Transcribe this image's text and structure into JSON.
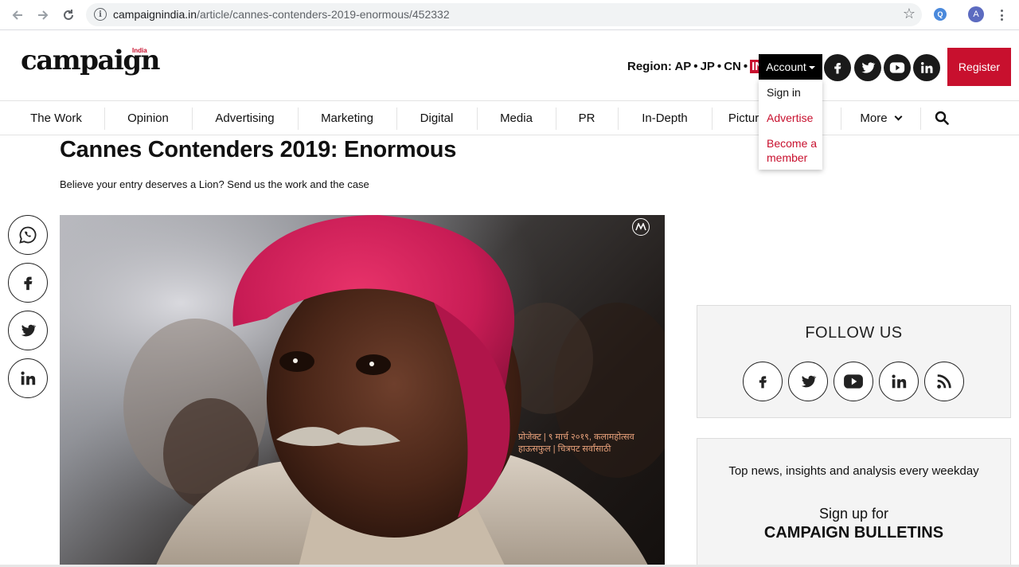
{
  "browser": {
    "url_host": "campaignindia.in",
    "url_path": "/article/cannes-contenders-2019-enormous/452332",
    "ext_label": "Q",
    "avatar_letter": "A"
  },
  "header": {
    "logo": "campaign",
    "logo_sup": "India",
    "region_label": "Region:",
    "regions": [
      "AP",
      "JP",
      "CN",
      "IN"
    ],
    "account_label": "Account",
    "register_label": "Register"
  },
  "account_menu": {
    "items": [
      {
        "label": "Sign in"
      },
      {
        "label": "Advertise"
      },
      {
        "label": "Become a member"
      }
    ]
  },
  "nav": {
    "items": [
      "The Work",
      "Opinion",
      "Advertising",
      "Marketing",
      "Digital",
      "Media",
      "PR",
      "In-Depth",
      "Pictures"
    ],
    "more_label": "More"
  },
  "article": {
    "title": "Cannes Contenders 2019: Enormous",
    "subtitle": "Believe your entry deserves a Lion? Send us the work and the case",
    "hero_caption_line1": "प्रोजेक्ट  | ९ मार्च २०१९, कलामहोत्सव",
    "hero_caption_line2": "हाऊसफुल | चित्रपट सर्वांसाठी"
  },
  "sidebar": {
    "follow_title": "FOLLOW US",
    "newsletter_text": "Top news, insights and analysis every weekday",
    "signup_line1": "Sign up for",
    "signup_line2": "CAMPAIGN BULLETINS"
  },
  "colors": {
    "brand_red": "#c8102e",
    "dark": "#1a1a1a"
  }
}
